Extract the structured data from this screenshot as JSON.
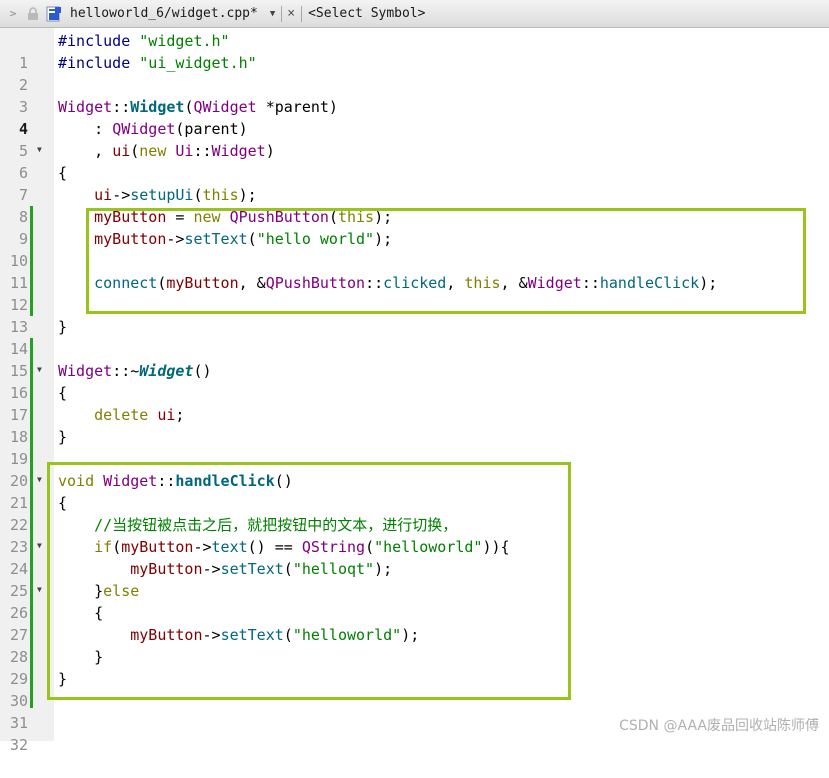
{
  "tab": {
    "file_name": "helloworld_6/widget.cpp*",
    "symbol_placeholder": "<Select Symbol>",
    "dropdown_glyph": "▼",
    "close_glyph": "×",
    "nav_glyph": ">"
  },
  "editor": {
    "current_line": 4,
    "line_numbers": [
      "1",
      "2",
      "3",
      "4",
      "5",
      "6",
      "7",
      "8",
      "9",
      "10",
      "11",
      "12",
      "13",
      "14",
      "15",
      "16",
      "17",
      "18",
      "19",
      "20",
      "21",
      "22",
      "23",
      "24",
      "25",
      "26",
      "27",
      "28",
      "29",
      "30",
      "31",
      "32"
    ],
    "lines": {
      "l1": {
        "a": "#include ",
        "b": "\"widget.h\""
      },
      "l2": {
        "a": "#include ",
        "b": "\"ui_widget.h\""
      },
      "l4": {
        "a": "Widget",
        "b": "::",
        "c": "Widget",
        "d": "(",
        "e": "QWidget",
        "f": " *parent)"
      },
      "l5": {
        "a": "    : ",
        "b": "QWidget",
        "c": "(parent)"
      },
      "l6": {
        "a": "    , ",
        "b": "ui",
        "c": "(",
        "d": "new",
        "e": " ",
        "f": "Ui",
        "g": "::",
        "h": "Widget",
        "i": ")"
      },
      "l7": {
        "a": "{"
      },
      "l8": {
        "a": "    ",
        "b": "ui",
        "c": "->",
        "d": "setupUi",
        "e": "(",
        "f": "this",
        "g": ");"
      },
      "l9": {
        "a": "    ",
        "b": "myButton",
        "c": " = ",
        "d": "new",
        "e": " ",
        "f": "QPushButton",
        "g": "(",
        "h": "this",
        "i": ");"
      },
      "l10": {
        "a": "    ",
        "b": "myButton",
        "c": "->",
        "d": "setText",
        "e": "(",
        "f": "\"hello world\"",
        "g": ");"
      },
      "l12": {
        "a": "    ",
        "b": "connect",
        "c": "(",
        "d": "myButton",
        "e": ", &",
        "f": "QPushButton",
        "g": "::",
        "h": "clicked",
        "i": ", ",
        "j": "this",
        "k": ", &",
        "l": "Widget",
        "m": "::",
        "n": "handleClick",
        "o": ");"
      },
      "l14": {
        "a": "}"
      },
      "l16": {
        "a": "Widget",
        "b": "::~",
        "c": "Widget",
        "d": "()"
      },
      "l17": {
        "a": "{"
      },
      "l18": {
        "a": "    ",
        "b": "delete",
        "c": " ",
        "d": "ui",
        "e": ";"
      },
      "l19": {
        "a": "}"
      },
      "l21": {
        "a": "void",
        "b": " ",
        "c": "Widget",
        "d": "::",
        "e": "handleClick",
        "f": "()"
      },
      "l22": {
        "a": "{"
      },
      "l23": {
        "a": "    ",
        "b": "//当按钮被点击之后，就把按钮中的文本，进行切换，"
      },
      "l24": {
        "a": "    ",
        "b": "if",
        "c": "(",
        "d": "myButton",
        "e": "->",
        "f": "text",
        "g": "() == ",
        "h": "QString",
        "i": "(",
        "j": "\"helloworld\"",
        "k": ")){"
      },
      "l25": {
        "a": "        ",
        "b": "myButton",
        "c": "->",
        "d": "setText",
        "e": "(",
        "f": "\"helloqt\"",
        "g": ");"
      },
      "l26": {
        "a": "    }",
        "b": "else"
      },
      "l27": {
        "a": "    {"
      },
      "l28": {
        "a": "        ",
        "b": "myButton",
        "c": "->",
        "d": "setText",
        "e": "(",
        "f": "\"helloworld\"",
        "g": ");"
      },
      "l29": {
        "a": "    }"
      },
      "l30": {
        "a": "}"
      }
    },
    "fold_glyph": "▼"
  },
  "colors": {
    "highlight_box": "#9ac31c",
    "change_bar": "#21a321",
    "keyword": "#808000",
    "type": "#800080",
    "function": "#00677c",
    "string": "#008000",
    "member": "#800000",
    "preprocessor": "#000080"
  },
  "watermark": "CSDN @AAA废品回收站陈师傅"
}
